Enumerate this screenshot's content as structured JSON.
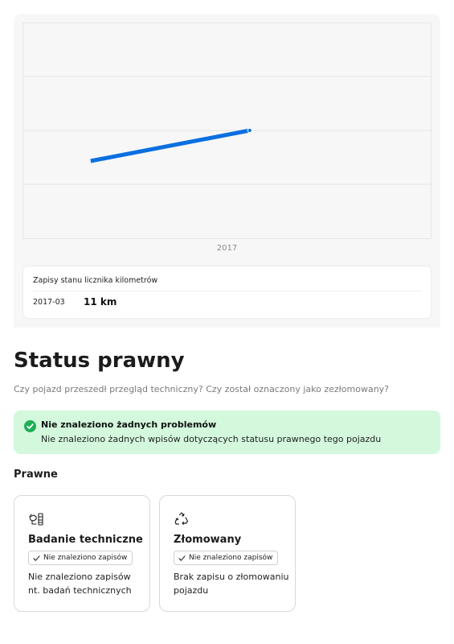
{
  "chart_data": {
    "type": "line",
    "title": "",
    "xlabel": "",
    "ylabel": "",
    "x_tick_labels": [
      "2017"
    ],
    "series": [
      {
        "color": "#0a6fe0",
        "points": [
          {
            "x": "2016-01",
            "y": 0
          },
          {
            "x": "2017-03",
            "y": 11
          }
        ]
      }
    ],
    "grid": true,
    "legend": "none"
  },
  "odometer": {
    "title": "Zapisy stanu licznika kilometrów",
    "records": [
      {
        "date": "2017-03",
        "value": "11 km"
      }
    ]
  },
  "legal_status": {
    "title": "Status prawny",
    "subtitle": "Czy pojazd przeszedł przegląd techniczny? Czy został oznaczony jako zezłomowany?",
    "notice": {
      "title": "Nie znaleziono żadnych problemów",
      "text": "Nie znaleziono żadnych wpisów dotyczących statusu prawnego tego pojazdu",
      "color": "#d3f8dc",
      "icon": "check-circle-icon"
    },
    "section_label": "Prawne",
    "cards": [
      {
        "title": "Badanie techniczne",
        "chip": "Nie znaleziono zapisów",
        "description": "Nie znaleziono zapisów nt. badań technicznych",
        "icon": "inspection-icon"
      },
      {
        "title": "Złomowany",
        "chip": "Nie znaleziono zapisów",
        "description": "Brak zapisu o złomowaniu pojazdu",
        "icon": "recycle-icon"
      }
    ]
  }
}
